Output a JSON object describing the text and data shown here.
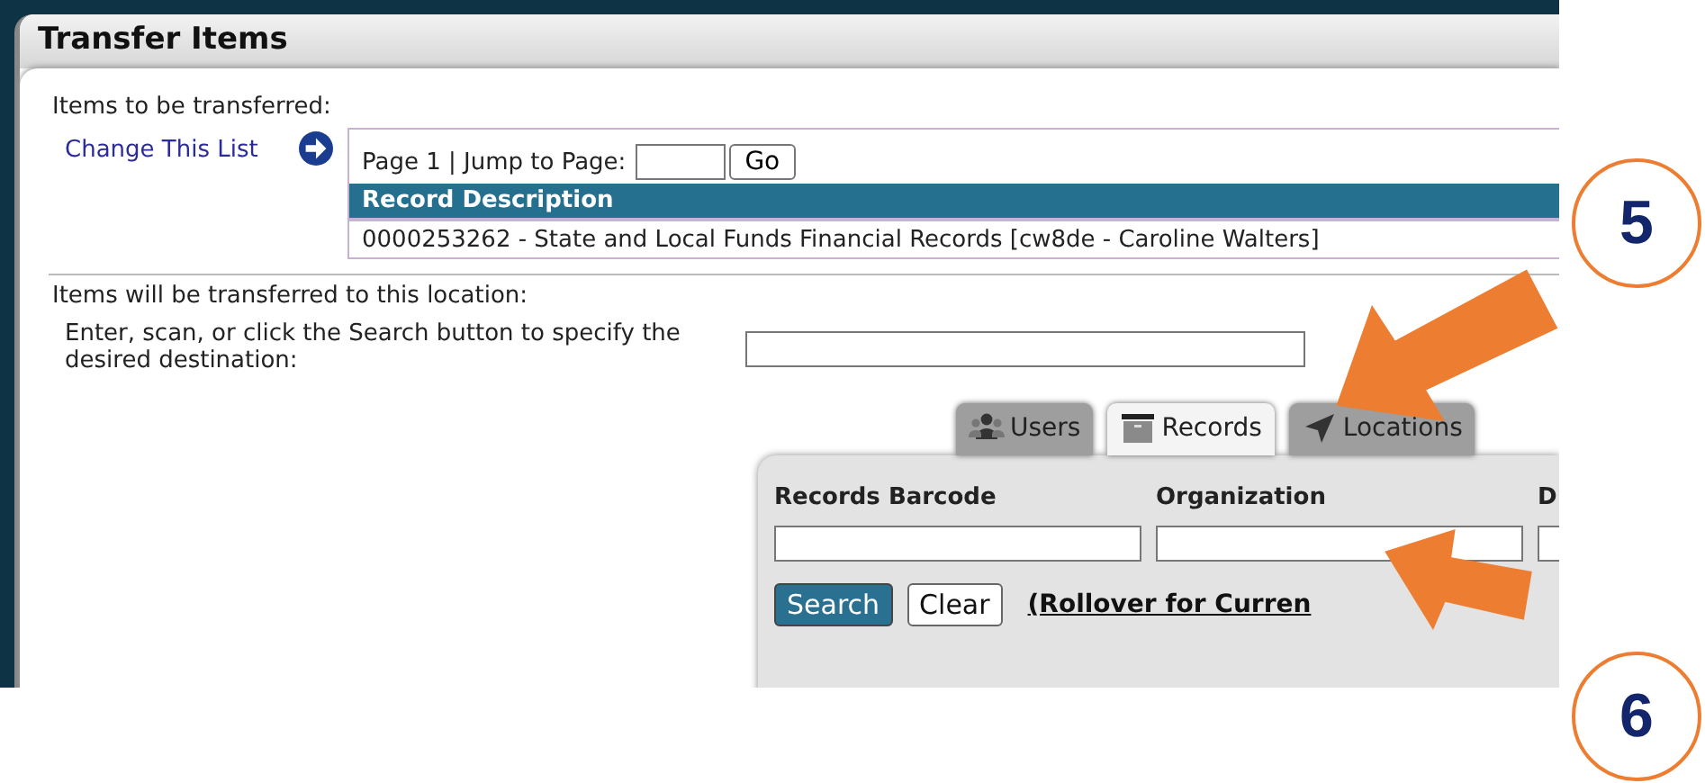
{
  "window": {
    "title": "Transfer Items"
  },
  "items_section": {
    "label": "Items to be transferred:",
    "change_link": "Change This List",
    "pager": {
      "page_text": "Page 1 | Jump to Page:",
      "button": "Go"
    },
    "table": {
      "columns": [
        "Record Description"
      ],
      "rows": [
        [
          "0000253262 - State and Local Funds Financial Records [cw8de - Caroline Walters]"
        ]
      ]
    }
  },
  "destination_section": {
    "label": "Items will be transferred to this location:",
    "instructions": "Enter, scan, or click the Search button to specify the desired destination:"
  },
  "tabs": [
    {
      "label": "Users",
      "kind": "users",
      "selected": false
    },
    {
      "label": "Records",
      "kind": "records",
      "selected": true
    },
    {
      "label": "Locations",
      "kind": "locations",
      "selected": false
    }
  ],
  "search_panel": {
    "fields": [
      {
        "label": "Records Barcode"
      },
      {
        "label": "Organization"
      },
      {
        "label": "D"
      }
    ],
    "buttons": [
      {
        "label": "Search",
        "kind": "primary"
      },
      {
        "label": "Clear",
        "kind": "plain"
      }
    ],
    "link": "(Rollover for Curren"
  },
  "annotations": [
    {
      "label": "5"
    },
    {
      "label": "6"
    }
  ]
}
